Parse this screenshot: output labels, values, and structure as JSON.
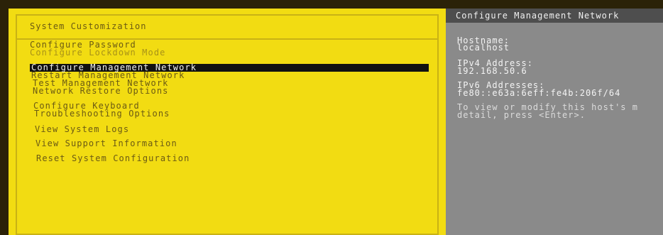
{
  "left": {
    "title": "System Customization",
    "menu": [
      {
        "label": "Configure Password"
      },
      {
        "label": "Configure Lockdown Mode"
      },
      {
        "label": "Configure Management Network"
      },
      {
        "label": "Restart Management Network"
      },
      {
        "label": "Test Management Network"
      },
      {
        "label": "Network Restore Options"
      },
      {
        "label": "Configure Keyboard"
      },
      {
        "label": "Troubleshooting Options"
      },
      {
        "label": "View System Logs"
      },
      {
        "label": "View Support Information"
      },
      {
        "label": "Reset System Configuration"
      }
    ]
  },
  "right": {
    "title": "Configure Management Network",
    "hostname_label": "Hostname:",
    "hostname_value": "localhost",
    "ipv4_label": "IPv4 Address:",
    "ipv4_value": "192.168.50.6",
    "ipv6_label": "IPv6 Addresses:",
    "ipv6_value": "fe80::e63a:6eff:fe4b:206f/64",
    "hint_line1": "To view or modify this host's m",
    "hint_line2": "detail, press <Enter>."
  },
  "colors": {
    "left_background": "#f2dc12",
    "right_background": "#8a8a8a",
    "selection_background": "#111111"
  }
}
